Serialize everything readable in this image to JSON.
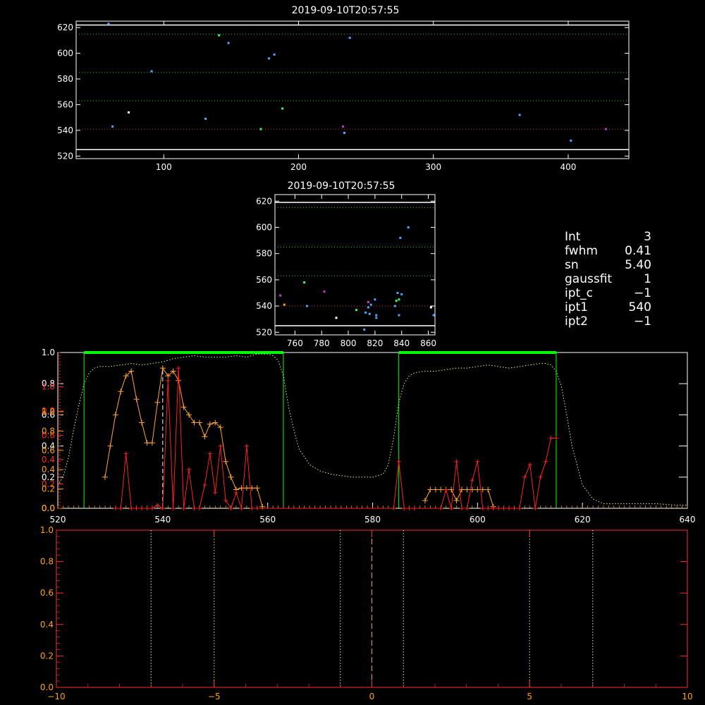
{
  "colors": {
    "background": "#000000",
    "axis_white": "#ffffff",
    "axis_red": "#ff2a2a",
    "axis_orange": "#ffa500",
    "green": "#00ff00",
    "dotted_green": "#33cc33",
    "dotted_red": "#cc2222",
    "dotted_white": "#dddddd",
    "profile_green": "#ccff99",
    "orange_series": "#ffa531",
    "red_series": "#ff2020"
  },
  "info_panel": [
    {
      "key": "Int",
      "value": "3"
    },
    {
      "key": "fwhm",
      "value": "0.41"
    },
    {
      "key": "sn",
      "value": "5.40"
    },
    {
      "key": "gaussfit",
      "value": "1"
    },
    {
      "key": "ipt_c",
      "value": "−1"
    },
    {
      "key": "ipt1",
      "value": "540"
    },
    {
      "key": "ipt2",
      "value": "−1"
    }
  ],
  "chart_data": [
    {
      "id": "scatter_top",
      "type": "scatter",
      "title": "2019-09-10T20:57:55",
      "xlim": [
        35,
        445
      ],
      "ylim": [
        518,
        625
      ],
      "xticks": [
        100,
        200,
        300,
        400
      ],
      "yticks": [
        520,
        540,
        560,
        580,
        600,
        620
      ],
      "hlines": [
        {
          "y": 622,
          "color": "#ffffff",
          "style": "solid"
        },
        {
          "y": 525,
          "color": "#ffffff",
          "style": "solid"
        },
        {
          "y": 615,
          "color": "#33cc33",
          "style": "dotted"
        },
        {
          "y": 585,
          "color": "#33cc33",
          "style": "dotted"
        },
        {
          "y": 563,
          "color": "#33cc33",
          "style": "dotted"
        },
        {
          "y": 541,
          "color": "#cc2222",
          "style": "dotted"
        }
      ],
      "points": [
        {
          "x": 59,
          "y": 623,
          "color": "#4aa8ff"
        },
        {
          "x": 62,
          "y": 543,
          "color": "#4aa8ff"
        },
        {
          "x": 74,
          "y": 554,
          "color": "#ffffff"
        },
        {
          "x": 91,
          "y": 586,
          "color": "#4aa8ff"
        },
        {
          "x": 131,
          "y": 549,
          "color": "#4aa8ff"
        },
        {
          "x": 141,
          "y": 614,
          "color": "#33ff66"
        },
        {
          "x": 148,
          "y": 608,
          "color": "#4aa8ff"
        },
        {
          "x": 172,
          "y": 541,
          "color": "#33ff66"
        },
        {
          "x": 178,
          "y": 596,
          "color": "#4aa8ff"
        },
        {
          "x": 182,
          "y": 599,
          "color": "#4aa8ff"
        },
        {
          "x": 188,
          "y": 557,
          "color": "#33ff66"
        },
        {
          "x": 233,
          "y": 543,
          "color": "#cc33cc"
        },
        {
          "x": 234,
          "y": 538,
          "color": "#4aa8ff"
        },
        {
          "x": 238,
          "y": 612,
          "color": "#4aa8ff"
        },
        {
          "x": 364,
          "y": 552,
          "color": "#4aa8ff"
        },
        {
          "x": 402,
          "y": 532,
          "color": "#4aa8ff"
        },
        {
          "x": 428,
          "y": 541,
          "color": "#cc33cc"
        }
      ]
    },
    {
      "id": "scatter_mid",
      "type": "scatter",
      "title": "2019-09-10T20:57:55",
      "xlim": [
        745,
        865
      ],
      "ylim": [
        518,
        625
      ],
      "xticks": [
        760,
        780,
        800,
        820,
        840,
        860
      ],
      "yticks": [
        520,
        540,
        560,
        580,
        600,
        620
      ],
      "hlines": [
        {
          "y": 619,
          "color": "#ffffff",
          "style": "solid"
        },
        {
          "y": 525,
          "color": "#ffffff",
          "style": "solid"
        },
        {
          "y": 615,
          "color": "#33cc33",
          "style": "dotted"
        },
        {
          "y": 585,
          "color": "#33cc33",
          "style": "dotted"
        },
        {
          "y": 563,
          "color": "#33cc33",
          "style": "dotted"
        },
        {
          "y": 540,
          "color": "#cc2222",
          "style": "dotted"
        }
      ],
      "points": [
        {
          "x": 749,
          "y": 548,
          "color": "#cc33cc"
        },
        {
          "x": 752,
          "y": 541,
          "color": "#ffa500"
        },
        {
          "x": 767,
          "y": 558,
          "color": "#33ff66"
        },
        {
          "x": 769,
          "y": 540,
          "color": "#4aa8ff"
        },
        {
          "x": 782,
          "y": 551,
          "color": "#cc33cc"
        },
        {
          "x": 791,
          "y": 531,
          "color": "#ffffff"
        },
        {
          "x": 806,
          "y": 537,
          "color": "#33ff66"
        },
        {
          "x": 812,
          "y": 522,
          "color": "#4aa8ff"
        },
        {
          "x": 813,
          "y": 535,
          "color": "#4aa8ff"
        },
        {
          "x": 815,
          "y": 539,
          "color": "#4aa8ff"
        },
        {
          "x": 815,
          "y": 543,
          "color": "#cc33cc"
        },
        {
          "x": 816,
          "y": 534,
          "color": "#4aa8ff"
        },
        {
          "x": 817,
          "y": 541,
          "color": "#4aa8ff"
        },
        {
          "x": 820,
          "y": 545,
          "color": "#4aa8ff"
        },
        {
          "x": 821,
          "y": 531,
          "color": "#4aa8ff"
        },
        {
          "x": 821,
          "y": 533,
          "color": "#4aa8ff"
        },
        {
          "x": 835,
          "y": 540,
          "color": "#4aa8ff"
        },
        {
          "x": 836,
          "y": 544,
          "color": "#33ff66"
        },
        {
          "x": 837,
          "y": 550,
          "color": "#4aa8ff"
        },
        {
          "x": 838,
          "y": 533,
          "color": "#4aa8ff"
        },
        {
          "x": 838,
          "y": 545,
          "color": "#33ff66"
        },
        {
          "x": 839,
          "y": 592,
          "color": "#4aa8ff"
        },
        {
          "x": 840,
          "y": 549,
          "color": "#4aa8ff"
        },
        {
          "x": 845,
          "y": 600,
          "color": "#4aa8ff"
        },
        {
          "x": 862,
          "y": 539,
          "color": "#ffffff"
        },
        {
          "x": 864,
          "y": 533,
          "color": "#4aa8ff"
        }
      ]
    },
    {
      "id": "profile",
      "type": "line",
      "xlim": [
        520,
        640
      ],
      "ylim": [
        0,
        1
      ],
      "xticks": [
        520,
        540,
        560,
        580,
        600,
        620,
        640
      ],
      "yticks_white": [
        0.0,
        0.2,
        0.4,
        0.6,
        0.8,
        1.0
      ],
      "yticks_red": [
        0.0,
        0.2,
        0.4,
        0.6,
        0.8,
        1.0
      ],
      "yticks_orange": [
        0.0,
        0.2,
        0.4,
        0.6,
        0.8,
        1.0
      ],
      "ytick_labels_white": [
        "0.0",
        "0.2",
        "0.4",
        "0.6",
        "0.8",
        "1.0"
      ],
      "ytick_labels_red": [
        "0.0",
        "0.2",
        "0.4",
        "0.6",
        "0.8",
        "1.0"
      ],
      "ytick_labels_orange": [
        "0.0",
        "0.2",
        "0.4",
        "0.6",
        "0.8",
        "1.0"
      ],
      "filter_boxes": [
        {
          "x0": 525,
          "x1": 563,
          "top": 1.0
        },
        {
          "x0": 585,
          "x1": 615,
          "top": 1.0
        }
      ],
      "vline_dashed": 540,
      "series": [
        {
          "key": "transmission",
          "style": "dotted",
          "color": "#ccff99",
          "x": [
            520,
            521,
            522,
            523,
            524,
            525,
            526,
            527,
            528,
            530,
            532,
            534,
            536,
            538,
            540,
            542,
            544,
            546,
            548,
            550,
            552,
            554,
            556,
            558,
            560,
            561,
            562,
            563,
            564,
            565,
            566,
            568,
            570,
            572,
            574,
            576,
            578,
            580,
            582,
            583,
            584,
            585,
            586,
            587,
            588,
            590,
            592,
            594,
            596,
            598,
            600,
            602,
            604,
            606,
            608,
            610,
            612,
            613,
            614,
            615,
            616,
            617,
            618,
            620,
            622,
            624,
            626,
            630,
            634,
            638,
            640
          ],
          "y": [
            0.15,
            0.2,
            0.32,
            0.5,
            0.66,
            0.8,
            0.87,
            0.9,
            0.91,
            0.91,
            0.92,
            0.93,
            0.92,
            0.93,
            0.94,
            0.96,
            0.97,
            0.98,
            0.97,
            0.97,
            0.97,
            0.98,
            0.97,
            0.99,
            0.99,
            0.98,
            0.95,
            0.85,
            0.65,
            0.5,
            0.38,
            0.28,
            0.24,
            0.22,
            0.21,
            0.2,
            0.2,
            0.2,
            0.22,
            0.28,
            0.45,
            0.68,
            0.8,
            0.85,
            0.87,
            0.88,
            0.88,
            0.89,
            0.9,
            0.9,
            0.91,
            0.92,
            0.91,
            0.9,
            0.91,
            0.92,
            0.93,
            0.93,
            0.92,
            0.88,
            0.78,
            0.6,
            0.4,
            0.15,
            0.06,
            0.03,
            0.03,
            0.03,
            0.03,
            0.02,
            0.02
          ]
        },
        {
          "key": "orange",
          "style": "line-plus",
          "color": "#ffa531",
          "x": [
            529,
            530,
            531,
            532,
            533,
            534,
            535,
            536,
            537,
            538,
            539,
            540,
            541,
            542,
            543,
            544,
            545,
            546,
            547,
            548,
            549,
            550,
            551,
            552,
            553,
            554,
            555,
            556,
            557,
            558,
            559
          ],
          "y": [
            0.2,
            0.4,
            0.6,
            0.75,
            0.85,
            0.88,
            0.7,
            0.55,
            0.42,
            0.42,
            0.68,
            0.9,
            0.85,
            0.88,
            0.82,
            0.65,
            0.6,
            0.55,
            0.55,
            0.46,
            0.54,
            0.55,
            0.52,
            0.3,
            0.2,
            0.12,
            0.13,
            0.13,
            0.13,
            0.13,
            0.01
          ]
        },
        {
          "key": "orange_right",
          "style": "line-plus",
          "color": "#ffa531",
          "x": [
            590,
            591,
            592,
            593,
            594,
            595,
            596,
            597,
            598,
            599,
            600,
            601,
            602,
            603
          ],
          "y": [
            0.05,
            0.12,
            0.12,
            0.12,
            0.12,
            0.12,
            0.05,
            0.12,
            0.12,
            0.12,
            0.12,
            0.12,
            0.12,
            0.01
          ]
        },
        {
          "key": "red",
          "style": "line-plus",
          "color": "#ff2020",
          "x": [
            530,
            531,
            532,
            533,
            534,
            535,
            536,
            537,
            538,
            539,
            540,
            541,
            542,
            543,
            544,
            545,
            546,
            547,
            548,
            549,
            550,
            551,
            552,
            553,
            554,
            555,
            556,
            557,
            558,
            559,
            560
          ],
          "y": [
            0.0,
            0.0,
            0.0,
            0.0,
            0.0,
            0.0,
            0.0,
            0.0,
            0.0,
            0.0,
            0.0,
            0.0,
            0.0,
            0.0,
            0.0,
            0.0,
            0.0,
            0.0,
            0.0,
            0.0,
            0.0,
            0.0,
            0.0,
            0.0,
            0.0,
            0.0,
            0.0,
            0.0,
            0.0,
            0.0,
            0.0
          ]
        }
      ],
      "red_spikes": {
        "x": [
          531,
          532,
          533,
          534,
          535,
          536,
          537,
          538,
          539,
          540,
          541,
          542,
          543,
          544,
          545,
          546,
          547,
          548,
          549,
          550,
          551,
          552,
          553,
          554,
          555,
          556,
          557,
          558,
          584,
          585,
          586,
          587,
          588,
          593,
          594,
          595,
          596,
          597,
          598,
          599,
          600,
          601,
          602,
          603,
          604,
          605,
          606,
          607,
          608,
          609,
          610,
          611,
          612,
          613,
          614,
          615
        ],
        "y": [
          0.0,
          0.0,
          0.35,
          0.0,
          0.0,
          0.0,
          0.0,
          0.0,
          0.02,
          0.0,
          0.82,
          0.0,
          0.9,
          0.0,
          0.25,
          0.0,
          0.0,
          0.15,
          0.35,
          0.1,
          0.4,
          0.05,
          0.0,
          0.1,
          0.0,
          0.4,
          0.0,
          0.0,
          0.0,
          0.3,
          0.0,
          0.0,
          0.0,
          0.0,
          0.12,
          0.0,
          0.3,
          0.0,
          0.0,
          0.18,
          0.3,
          0.0,
          0.0,
          0.0,
          0.0,
          0.0,
          0.0,
          0.0,
          0.0,
          0.2,
          0.28,
          0.0,
          0.2,
          0.3,
          0.45,
          0.45
        ]
      }
    },
    {
      "id": "velocity",
      "type": "line",
      "xlim": [
        -10,
        10
      ],
      "ylim": [
        0,
        1
      ],
      "xticks": [
        -10,
        -5,
        0,
        5,
        10
      ],
      "xtick_labels": [
        "−10",
        "−5",
        "0",
        "5",
        "10"
      ],
      "yticks": [
        0.0,
        0.2,
        0.4,
        0.6,
        0.8,
        1.0
      ],
      "ytick_labels": [
        "0.0",
        "0.2",
        "0.4",
        "0.6",
        "0.8",
        "1.0"
      ],
      "vlines_dotted": [
        -7,
        -5,
        -1,
        1,
        5,
        7
      ],
      "vline_dashed": 0
    }
  ]
}
